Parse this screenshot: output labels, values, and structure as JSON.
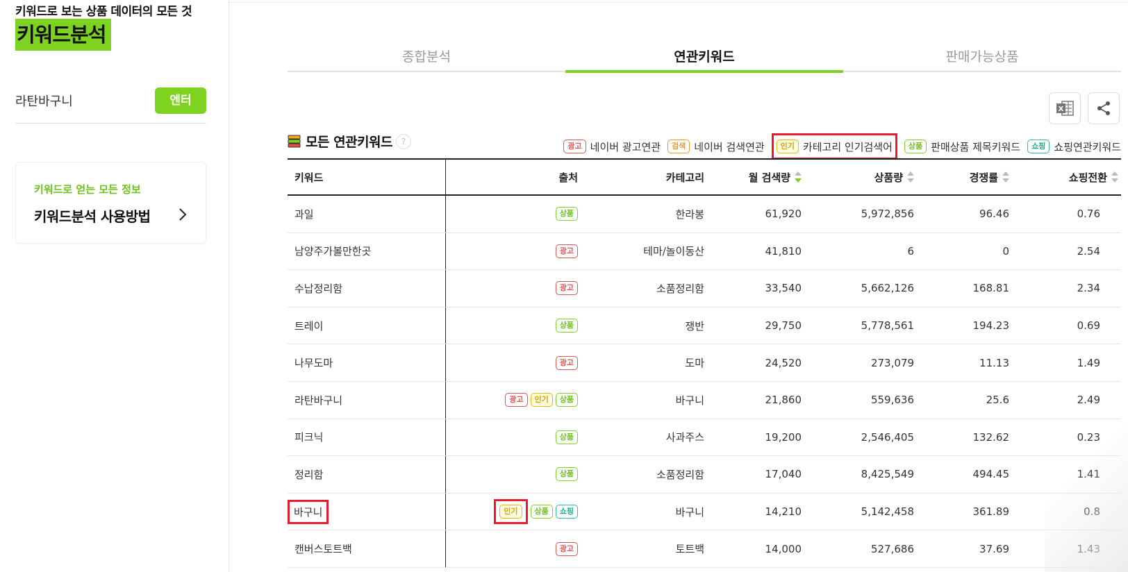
{
  "brand": {
    "subtitle": "키워드로 보는 상품 데이터의 모든 것",
    "title": "키워드분석"
  },
  "search": {
    "value": "라탄바구니",
    "button_label": "엔터"
  },
  "info_card": {
    "subtitle": "키워드로 얻는 모든 정보",
    "title": "키워드분석 사용방법"
  },
  "tabs": [
    {
      "label": "종합분석",
      "active": false
    },
    {
      "label": "연관키워드",
      "active": true
    },
    {
      "label": "판매가능상품",
      "active": false
    }
  ],
  "section": {
    "title": "모든 연관키워드",
    "help": "?"
  },
  "legend": [
    {
      "badge": "광고",
      "label": "네이버 광고연관",
      "type": "ad"
    },
    {
      "badge": "검색",
      "label": "네이버 검색연관",
      "type": "search"
    },
    {
      "badge": "인기",
      "label": "카테고리 인기검색어",
      "type": "popular"
    },
    {
      "badge": "상품",
      "label": "판매상품 제목키워드",
      "type": "product"
    },
    {
      "badge": "쇼핑",
      "label": "쇼핑연관키워드",
      "type": "shopping"
    }
  ],
  "table": {
    "headers": {
      "keyword": "키워드",
      "source": "출처",
      "category": "카테고리",
      "volume": "월 검색량",
      "products": "상품량",
      "competition": "경쟁률",
      "shopping": "쇼핑전환"
    },
    "rows": [
      {
        "keyword": "과일",
        "sources": [
          "상품"
        ],
        "category": "한라봉",
        "volume": "61,920",
        "products": "5,972,856",
        "competition": "96.46",
        "shopping": "0.76"
      },
      {
        "keyword": "남양주가볼만한곳",
        "sources": [
          "광고"
        ],
        "category": "테마/놀이동산",
        "volume": "41,810",
        "products": "6",
        "competition": "0",
        "shopping": "2.54"
      },
      {
        "keyword": "수납정리함",
        "sources": [
          "광고"
        ],
        "category": "소품정리함",
        "volume": "33,540",
        "products": "5,662,126",
        "competition": "168.81",
        "shopping": "2.34"
      },
      {
        "keyword": "트레이",
        "sources": [
          "상품"
        ],
        "category": "쟁반",
        "volume": "29,750",
        "products": "5,778,561",
        "competition": "194.23",
        "shopping": "0.69"
      },
      {
        "keyword": "나무도마",
        "sources": [
          "광고"
        ],
        "category": "도마",
        "volume": "24,520",
        "products": "273,079",
        "competition": "11.13",
        "shopping": "1.49"
      },
      {
        "keyword": "라탄바구니",
        "sources": [
          "광고",
          "인기",
          "상품"
        ],
        "category": "바구니",
        "volume": "21,860",
        "products": "559,636",
        "competition": "25.6",
        "shopping": "2.49"
      },
      {
        "keyword": "피크닉",
        "sources": [
          "상품"
        ],
        "category": "사과주스",
        "volume": "19,200",
        "products": "2,546,405",
        "competition": "132.62",
        "shopping": "0.23"
      },
      {
        "keyword": "정리함",
        "sources": [
          "상품"
        ],
        "category": "소품정리함",
        "volume": "17,040",
        "products": "8,425,549",
        "competition": "494.45",
        "shopping": "1.41"
      },
      {
        "keyword": "바구니",
        "sources": [
          "인기",
          "상품",
          "쇼핑"
        ],
        "category": "바구니",
        "volume": "14,210",
        "products": "5,142,458",
        "competition": "361.89",
        "shopping": "0.8"
      },
      {
        "keyword": "캔버스토트백",
        "sources": [
          "광고"
        ],
        "category": "토트백",
        "volume": "14,000",
        "products": "527,686",
        "competition": "37.69",
        "shopping": "1.43"
      }
    ]
  },
  "colors": {
    "accent": "#7ed321",
    "highlight": "#e81a2b"
  }
}
